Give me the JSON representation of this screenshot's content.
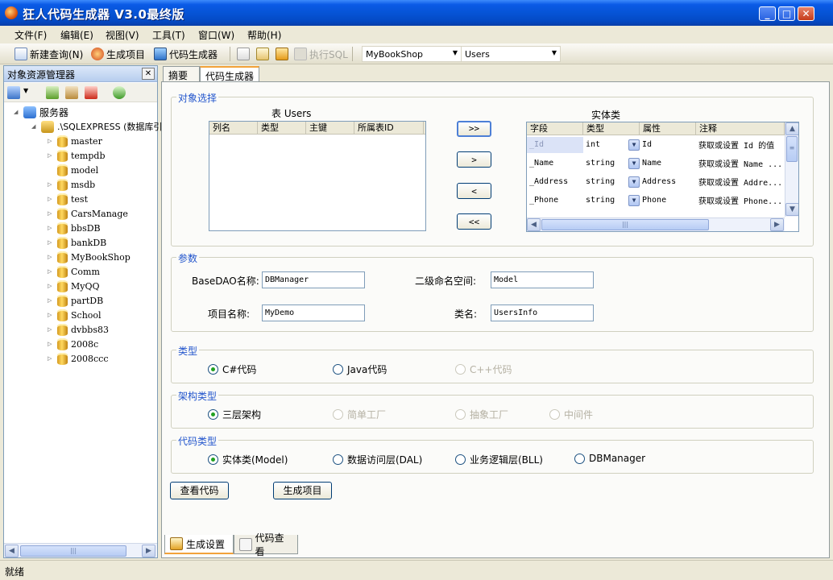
{
  "window": {
    "title": "狂人代码生成器 V3.0最终版",
    "min": "_",
    "max": "□",
    "close": "✕"
  },
  "menu": [
    "文件(F)",
    "编辑(E)",
    "视图(V)",
    "工具(T)",
    "窗口(W)",
    "帮助(H)"
  ],
  "toolbar": {
    "new_query": "新建查询(N)",
    "gen_project": "生成项目",
    "code_gen": "代码生成器",
    "exec_sql": "执行SQL",
    "db_combo": "MyBookShop",
    "table_combo": "Users"
  },
  "explorer": {
    "title": "对象资源管理器",
    "server": "服务器",
    "instance": ".\\SQLEXPRESS (数据库引擎)",
    "databases": [
      "master",
      "tempdb",
      "model",
      "msdb",
      "test",
      "CarsManage",
      "bbsDB",
      "bankDB",
      "MyBookShop",
      "Comm",
      "MyQQ",
      "partDB",
      "School",
      "dvbbs83",
      "2008c",
      "2008ccc"
    ]
  },
  "tabs": {
    "summary": "摘要",
    "code_gen": "代码生成器"
  },
  "object_select": {
    "group": "对象选择",
    "table_title": "表 Users",
    "table_cols": [
      "列名",
      "类型",
      "主键",
      "所属表ID"
    ],
    "entity_title": "实体类",
    "entity_cols": [
      "字段",
      "类型",
      "属性",
      "注释"
    ],
    "entity_rows": [
      {
        "field": "_Id",
        "type": "int",
        "prop": "Id",
        "note": "获取或设置 Id 的值"
      },
      {
        "field": "_Name",
        "type": "string",
        "prop": "Name",
        "note": "获取或设置 Name ..."
      },
      {
        "field": "_Address",
        "type": "string",
        "prop": "Address",
        "note": "获取或设置 Addre..."
      },
      {
        "field": "_Phone",
        "type": "string",
        "prop": "Phone",
        "note": "获取或设置 Phone..."
      }
    ],
    "btn_all_right": ">>",
    "btn_right": ">",
    "btn_left": "<",
    "btn_all_left": "<<"
  },
  "params": {
    "group": "参数",
    "basedao_label": "BaseDAO名称:",
    "basedao_value": "DBManager",
    "namespace_label": "二级命名空间:",
    "namespace_value": "Model",
    "project_label": "项目名称:",
    "project_value": "MyDemo",
    "class_label": "类名:",
    "class_value": "UsersInfo"
  },
  "lang": {
    "group": "类型",
    "csharp": "C#代码",
    "java": "Java代码",
    "cpp": "C++代码"
  },
  "arch": {
    "group": "架构类型",
    "three_tier": "三层架构",
    "simple_factory": "简单工厂",
    "abstract_factory": "抽象工厂",
    "middleware": "中间件"
  },
  "codetype": {
    "group": "代码类型",
    "model": "实体类(Model)",
    "dal": "数据访问层(DAL)",
    "bll": "业务逻辑层(BLL)",
    "dbmanager": "DBManager"
  },
  "actions": {
    "view_code": "查看代码",
    "gen_project": "生成项目"
  },
  "bottom_tabs": {
    "settings": "生成设置",
    "view": "代码查看"
  },
  "status": "就绪",
  "colors": {
    "accent": "#0654d6",
    "group_label": "#2255cc",
    "tab_highlight": "#f2a23a"
  }
}
